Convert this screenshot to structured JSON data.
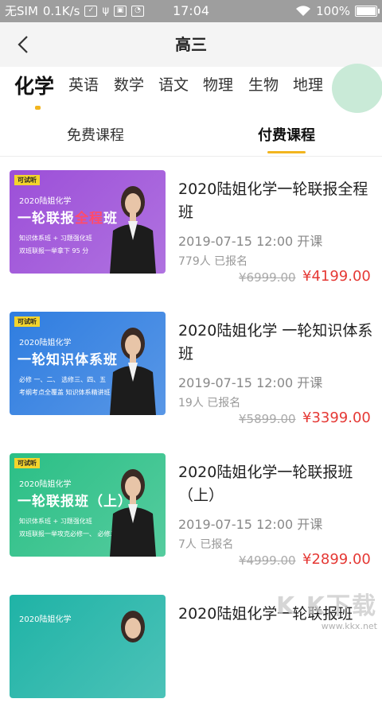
{
  "status_bar": {
    "carrier": "无SIM",
    "speed": "0.1K/s",
    "time": "17:04",
    "battery": "100%",
    "battery_level": 1.0
  },
  "header": {
    "title": "高三"
  },
  "subjects": {
    "items": [
      "化学",
      "英语",
      "数学",
      "语文",
      "物理",
      "生物",
      "地理"
    ],
    "active_index": 0
  },
  "course_types": {
    "items": [
      "免费课程",
      "付费课程"
    ],
    "active_index": 1
  },
  "courses": [
    {
      "title": "2020陆姐化学一轮联报全程班",
      "time": "2019-07-15 12:00 开课",
      "enrolled": "779人 已报名",
      "original_price": "¥6999.00",
      "price": "¥4199.00",
      "thumb": {
        "brand": "可试听",
        "line1": "2020陆姐化学",
        "line2_a": "一轮联报",
        "line2_b": "全程",
        "line2_c": "班",
        "line3": "知识体系班 + 习题强化班",
        "line4": "双班联报一举拿下 95 分",
        "bg": "#9c4fd8"
      }
    },
    {
      "title": "2020陆姐化学 一轮知识体系班",
      "time": "2019-07-15 12:00 开课",
      "enrolled": "19人 已报名",
      "original_price": "¥5899.00",
      "price": "¥3399.00",
      "thumb": {
        "brand": "可试听",
        "line1": "2020陆姐化学",
        "line2_a": "一轮知识体系班",
        "line2_b": "",
        "line2_c": "",
        "line3": "必修 一、二、 选修三、四、五",
        "line4": "考纲考点全覆盖 知识体系精讲班",
        "bg": "#2f7de0"
      }
    },
    {
      "title": "2020陆姐化学一轮联报班（上）",
      "time": "2019-07-15 12:00 开课",
      "enrolled": "7人 已报名",
      "original_price": "¥4999.00",
      "price": "¥2899.00",
      "thumb": {
        "brand": "可试听",
        "line1": "2020陆姐化学",
        "line2_a": "一轮联报班（上）",
        "line2_b": "",
        "line2_c": "",
        "line3": "知识体系班 + 习题强化班",
        "line4": "双班联报一举攻克必修一、 必修二",
        "bg": "#2bbf86"
      }
    },
    {
      "title": "2020陆姐化学一轮联报班",
      "time": "",
      "enrolled": "",
      "original_price": "",
      "price": "",
      "thumb": {
        "brand": "",
        "line1": "2020陆姐化学",
        "line2_a": "",
        "line2_b": "",
        "line2_c": "",
        "line3": "",
        "line4": "",
        "bg": "#1fb3a6"
      }
    }
  ],
  "watermark": {
    "big": "K K下载",
    "small": "www.kkx.net"
  },
  "colors": {
    "accent": "#f2b51f",
    "price": "#e53935",
    "status_bar": "#9e9e9e",
    "header_bg": "#f4f4f4"
  }
}
